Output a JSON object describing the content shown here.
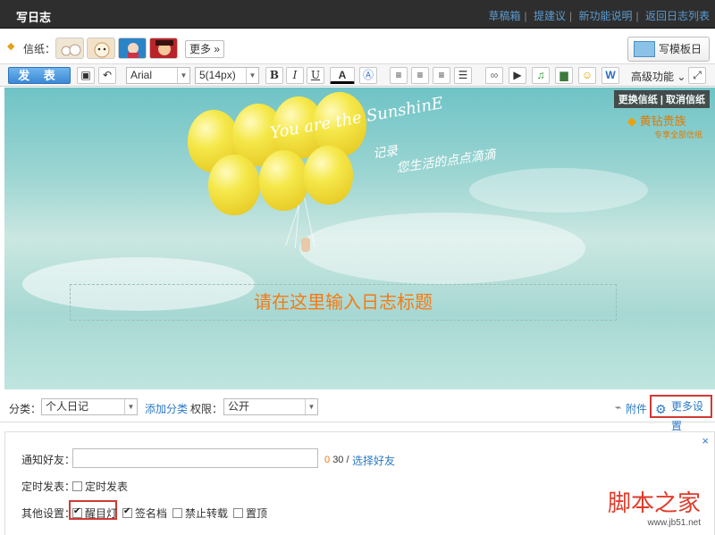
{
  "header": {
    "title": "写日志",
    "links": [
      "草稿箱",
      "提建议",
      "新功能说明",
      "返回日志列表"
    ]
  },
  "stationery": {
    "label": "信纸：",
    "more": "更多",
    "template_button": "写模板日志"
  },
  "toolbar": {
    "publish": "发 表",
    "font": "Arial",
    "size": "5(14px)",
    "bold": "B",
    "italic": "I",
    "underline": "U",
    "font_color": "A",
    "advanced": "高级功能"
  },
  "canvas": {
    "paper_ops": "更换信纸 | 取消信纸",
    "vip_name": "黄钻贵族",
    "vip_sub": "专享全部信纸",
    "script_en": "You are the SunshinE",
    "script_cn1": "记录",
    "script_cn2": "您生活的点点滴滴",
    "title_placeholder": "请在这里输入日志标题"
  },
  "category": {
    "label": "分类：",
    "value": "个人日记",
    "add": "添加分类",
    "perm_label": "权限：",
    "perm_value": "公开",
    "attach": "附件",
    "more_settings": "更多设置"
  },
  "settings": {
    "close": "×",
    "notify_label": "通知好友：",
    "count_used": "0",
    "count_total": "30",
    "choose_friends": "选择好友",
    "timed_label": "定时发表：",
    "timed_option": "定时发表",
    "other_label": "其他设置：",
    "options": [
      "醒目灯",
      "签名档",
      "禁止转载",
      "置顶"
    ],
    "checked": [
      true,
      true,
      false,
      false
    ]
  },
  "watermark": {
    "text": "脚本之家",
    "url": "www.jb51.net"
  }
}
